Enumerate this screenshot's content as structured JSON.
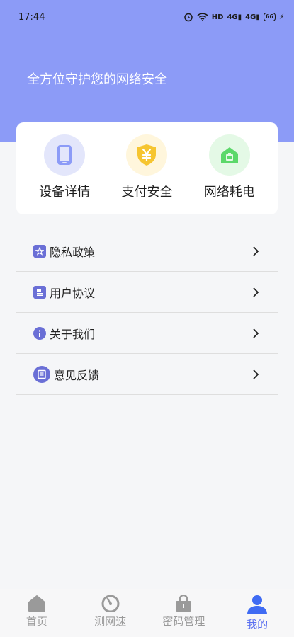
{
  "status_bar": {
    "time": "17:44",
    "network_label": "HD",
    "signal_1": "4G",
    "signal_2": "4G",
    "battery": "66"
  },
  "header": {
    "tagline": "全方位守护您的网络安全"
  },
  "features": [
    {
      "label": "设备详情",
      "icon": "phone-icon",
      "bg": "#e3e6fb",
      "fg": "#8c9bf7"
    },
    {
      "label": "支付安全",
      "icon": "yen-shield-icon",
      "bg": "#fff6dc",
      "fg": "#f6c530"
    },
    {
      "label": "网络耗电",
      "icon": "house-battery-icon",
      "bg": "#e4f9e6",
      "fg": "#5bd86a"
    }
  ],
  "menu": [
    {
      "label": "隐私政策",
      "icon": "privacy-policy-icon"
    },
    {
      "label": "用户协议",
      "icon": "user-agreement-icon"
    },
    {
      "label": "关于我们",
      "icon": "info-icon"
    },
    {
      "label": "意见反馈",
      "icon": "feedback-icon"
    }
  ],
  "tabs": [
    {
      "label": "首页",
      "icon": "home-icon"
    },
    {
      "label": "测网速",
      "icon": "speedometer-icon"
    },
    {
      "label": "密码管理",
      "icon": "lock-icon"
    },
    {
      "label": "我的",
      "icon": "profile-icon",
      "active": true
    }
  ],
  "colors": {
    "header": "#8c9bf7",
    "accent": "#5a6ff0",
    "menu_icon": "#6a6fd6"
  }
}
